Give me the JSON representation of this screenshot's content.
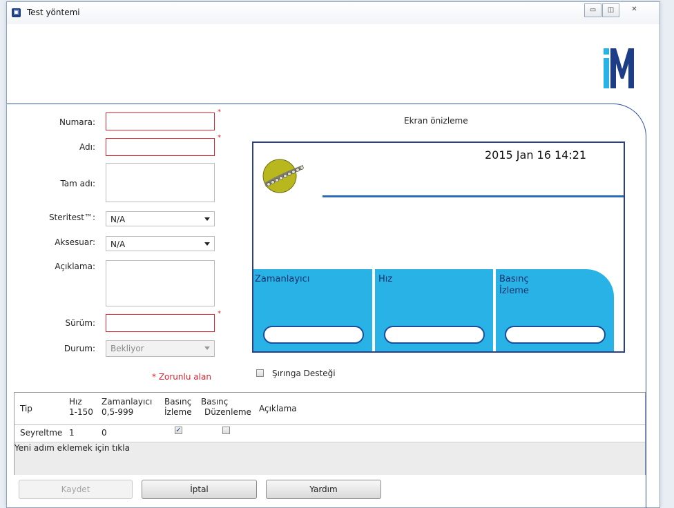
{
  "window": {
    "title": "Test yöntemi",
    "icon": "app-icon",
    "controls": [
      "minimize-icon",
      "maximize-icon",
      "close-icon"
    ]
  },
  "logo_letter": "M",
  "form": {
    "numara_label": "Numara:",
    "adi_label": "Adı:",
    "tam_adi_label": "Tam adı:",
    "steritest_label": "Steritest™:",
    "steritest_value": "N/A",
    "aksesuar_label": "Aksesuar:",
    "aksesuar_value": "N/A",
    "aciklama_label": "Açıklama:",
    "surum_label": "Sürüm:",
    "durum_label": "Durum:",
    "durum_value": "Bekliyor",
    "required_star": "*",
    "required_note": "* Zorunlu alan"
  },
  "preview": {
    "title": "Ekran önizleme",
    "datetime": "2015 Jan 16   14:21",
    "tiles": [
      "Zamanlayıcı",
      "Hız",
      "Basınç İzleme"
    ],
    "tile3_line1": "Basınç",
    "tile3_line2": "İzleme"
  },
  "syringe_support": {
    "label": "Şırınga Desteği",
    "checked": false
  },
  "grid": {
    "headers": {
      "tip": "Tip",
      "hiz1": "Hız",
      "hiz2": "1-150",
      "zam1": "Zamanlayıcı",
      "zam2": "0,5-999",
      "bi1": "Basınç",
      "bi2": "İzleme",
      "bd1": "Basınç",
      "bd2": "Düzenleme",
      "aciklama": "Açıklama"
    },
    "rows": [
      {
        "tip": "Seyreltme",
        "hiz": "1",
        "zamanlayici": "0",
        "basinc_izleme": true,
        "basinc_duzenleme": false,
        "aciklama": ""
      }
    ],
    "add_row_text": "Yeni adım eklemek için tıkla"
  },
  "buttons": {
    "save": "Kaydet",
    "cancel": "İptal",
    "help": "Yardım"
  },
  "colors": {
    "required_border": "#d9232d",
    "tile_blue": "#29b2e6",
    "frame_blue": "#2b3e8c"
  }
}
